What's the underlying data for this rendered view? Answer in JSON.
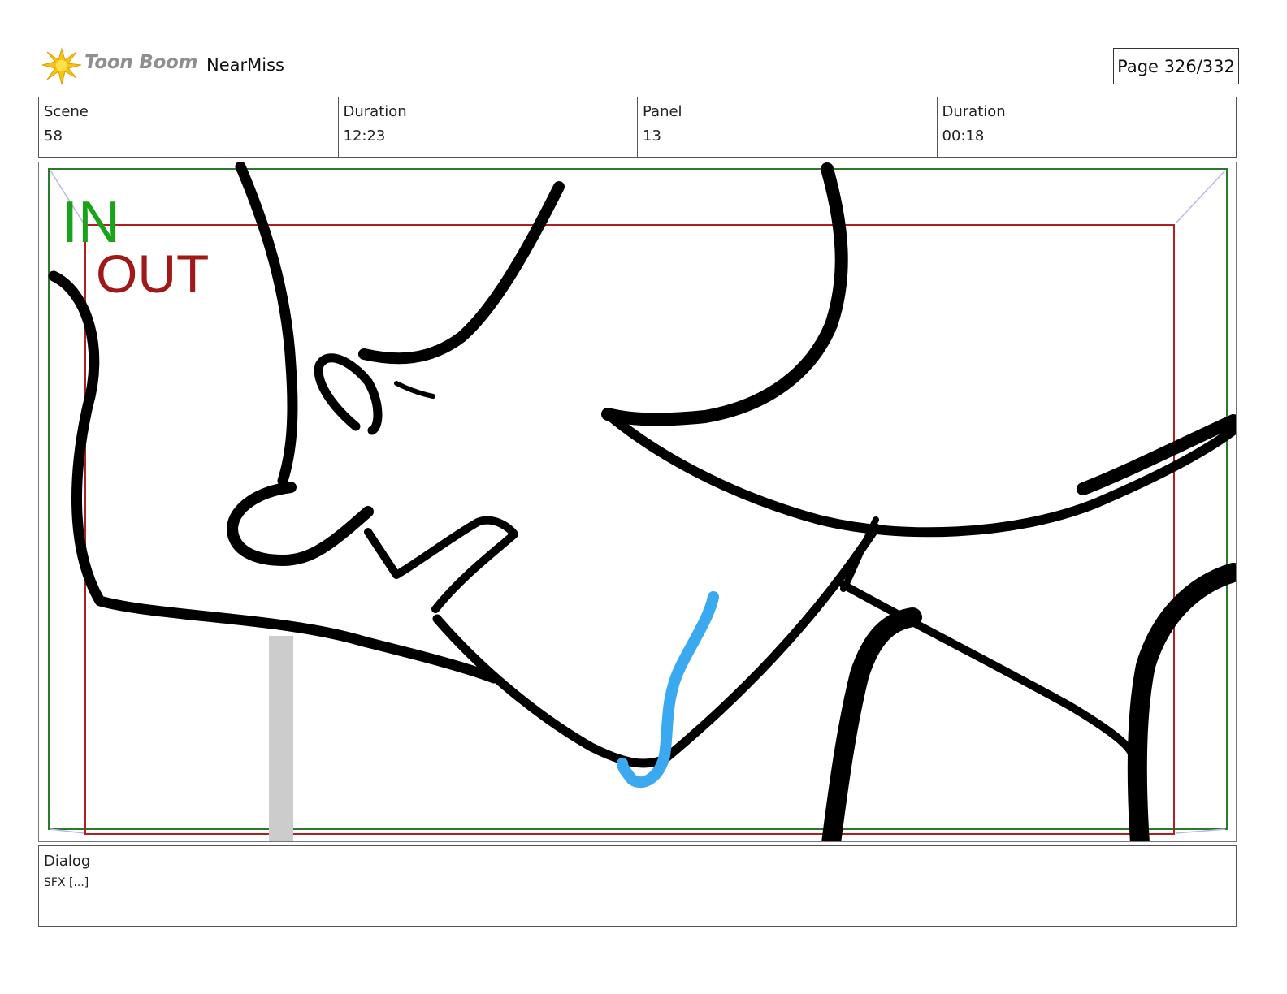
{
  "header": {
    "logo_text": "Toon Boom",
    "project_name": "NearMiss",
    "page_label": "Page 326/332"
  },
  "info": {
    "scene_label": "Scene",
    "scene_value": "58",
    "duration_label": "Duration",
    "duration_value": "12:23",
    "panel_label": "Panel",
    "panel_value": "13",
    "panel_duration_label": "Duration",
    "panel_duration_value": "00:18"
  },
  "panel_image": {
    "in_label": "IN",
    "out_label": "OUT",
    "in_color": "#1aa31a",
    "out_color": "#a01818"
  },
  "dialog": {
    "label": "Dialog",
    "text": "SFX [...]"
  }
}
